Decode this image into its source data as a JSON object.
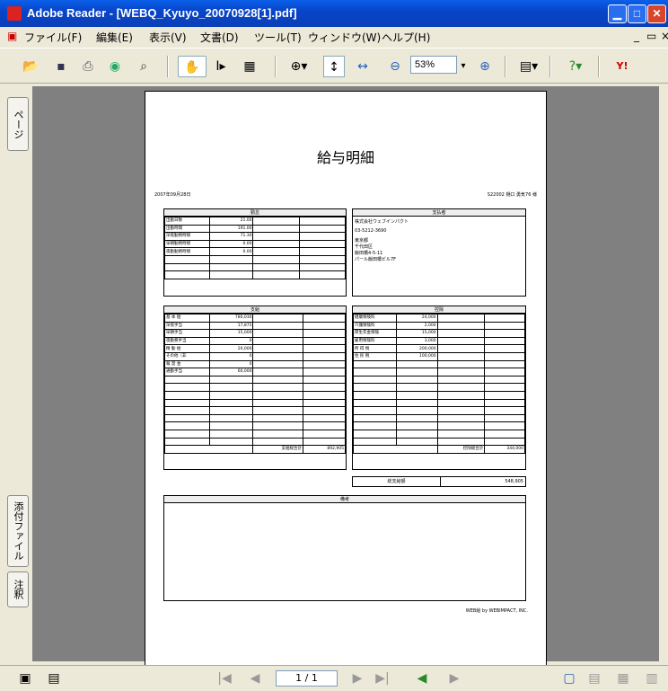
{
  "window": {
    "title": "Adobe Reader - [WEBQ_Kyuyo_20070928[1].pdf]"
  },
  "menu": [
    "ファイル(F)",
    "編集(E)",
    "表示(V)",
    "文書(D)",
    "ツール(T)",
    "ウィンドウ(W)",
    "ヘルプ(H)"
  ],
  "toolbar": {
    "zoom": "53%"
  },
  "navpane": {
    "pages_tab": "ページ",
    "attach_tab": "添付ファイル",
    "comments_tab": "注釈"
  },
  "status": {
    "page": "1 / 1"
  },
  "doc": {
    "title": "給与明細",
    "date": "2007年09月28日",
    "employee": "S22002 樋口 勇気76 様",
    "attendance": {
      "header": "勤怠",
      "rows": [
        {
          "label": "出勤日数",
          "value": "21.00"
        },
        {
          "label": "出勤時間",
          "value": "191.00"
        },
        {
          "label": "深夜勤務時間",
          "value": "71.30"
        },
        {
          "label": "早朝勤務時間",
          "value": "0.00"
        },
        {
          "label": "夜勤勤務時間",
          "value": "0.00"
        },
        {
          "label": "",
          "value": ""
        },
        {
          "label": "",
          "value": ""
        },
        {
          "label": "",
          "value": ""
        }
      ]
    },
    "payer": {
      "header": "支払者",
      "lines": [
        "株式会社ウェブインパクト",
        "03-5212-3690",
        "東京都",
        "千代田区",
        "飯田橋4-5-11",
        "パール飯田橋ビル7F"
      ]
    },
    "payment": {
      "header": "支給",
      "rows": [
        {
          "label": "基 本 給",
          "value": "780,030"
        },
        {
          "label": "深夜手当",
          "value": "17,875"
        },
        {
          "label": "早朝手当",
          "value": "15,000"
        },
        {
          "label": "夜勤務手当",
          "value": "0"
        },
        {
          "label": "精 勤 給",
          "value": "20,000"
        },
        {
          "label": "その他（非",
          "value": "0"
        },
        {
          "label": "報 奨 金",
          "value": "0"
        },
        {
          "label": "通勤手当",
          "value": "60,000"
        }
      ],
      "empty_rows": 9,
      "total_label": "支給総合計",
      "total": "892,905"
    },
    "deduction": {
      "header": "控除",
      "rows": [
        {
          "label": "健康保険料",
          "value": "24,000"
        },
        {
          "label": "介護保険料",
          "value": "2,000"
        },
        {
          "label": "厚生年金保険",
          "value": "15,000"
        },
        {
          "label": "雇用保険料",
          "value": "3,000"
        },
        {
          "label": "所 得 税",
          "value": "200,000"
        },
        {
          "label": "住 民 税",
          "value": "100,000"
        }
      ],
      "empty_rows": 11,
      "total_label": "控除総合計",
      "total": "344,000"
    },
    "net": {
      "label": "総支給額",
      "value": "548,905"
    },
    "remarks": {
      "header": "備考"
    },
    "footer": "WEB給 by WEBIMPACT, INC."
  }
}
